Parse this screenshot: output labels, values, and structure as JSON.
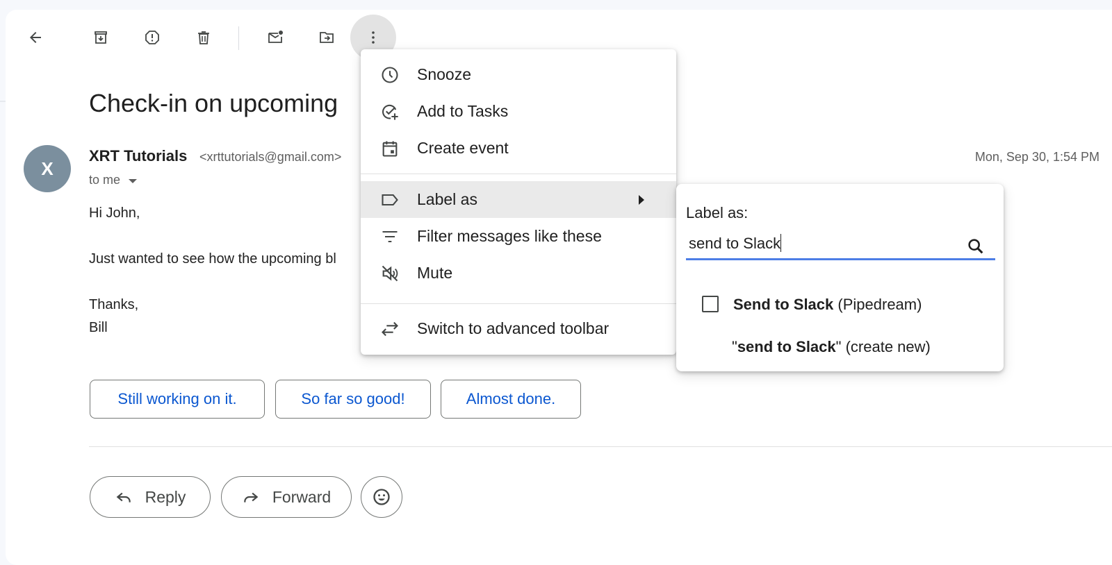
{
  "toolbar": {
    "back": "back-arrow-icon",
    "archive": "archive-icon",
    "report_spam": "report-spam-icon",
    "delete": "delete-icon",
    "mark_unread": "mark-unread-icon",
    "move_to": "move-to-icon",
    "more": "more-vertical-icon"
  },
  "email": {
    "subject": "Check-in on upcoming",
    "avatar_letter": "X",
    "sender_name": "XRT Tutorials",
    "sender_email": "<xrttutorials@gmail.com>",
    "recipient": "to me",
    "date": "Mon, Sep 30, 1:54 PM",
    "body": {
      "greeting": "Hi John,",
      "line1": "Just wanted to see how the upcoming bl",
      "signoff": "Thanks,",
      "name": "Bill"
    }
  },
  "smart_replies": [
    "Still working on it.",
    "So far so good!",
    "Almost done."
  ],
  "actions": {
    "reply": "Reply",
    "forward": "Forward"
  },
  "menu": {
    "snooze": "Snooze",
    "add_to_tasks": "Add to Tasks",
    "create_event": "Create event",
    "label_as": "Label as",
    "filter": "Filter messages like these",
    "mute": "Mute",
    "switch_toolbar": "Switch to advanced toolbar"
  },
  "label_panel": {
    "title": "Label as:",
    "input_value": "send to Slack",
    "option1_bold": "Send to Slack",
    "option1_rest": " (Pipedream)",
    "option2_quote_open": "\"",
    "option2_bold": "send to Slack",
    "option2_rest": "\" (create new)"
  },
  "colors": {
    "accent": "#0b57d0",
    "avatar": "#7b8f9e",
    "input_underline": "#4c7de6",
    "menu_hover": "#eaeaea"
  }
}
